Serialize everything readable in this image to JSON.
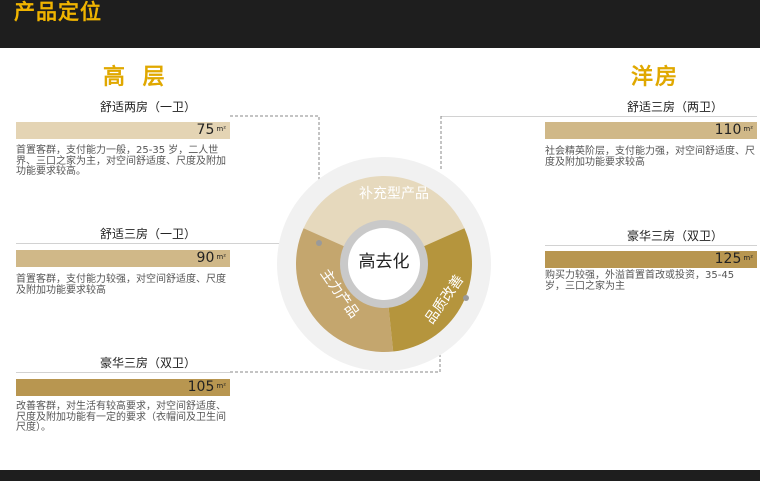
{
  "header": {
    "title": "产品定位"
  },
  "left": {
    "title": "高 层",
    "products": [
      {
        "name": "舒适两房（一卫）",
        "area": "75",
        "unit": "m²",
        "desc": "首置客群，支付能力一般，25-35 岁，二人世界、三口之家为主，对空间舒适度、尺度及附加功能要求较高。"
      },
      {
        "name": "舒适三房（一卫）",
        "area": "90",
        "unit": "m²",
        "desc": "首置客群，支付能力较强，对空间舒适度、尺度及附加功能要求较高"
      },
      {
        "name": "豪华三房（双卫）",
        "area": "105",
        "unit": "m²",
        "desc": "改善客群，对生活有较高要求，对空间舒适度、尺度及附加功能有一定的要求（衣帽间及卫生间尺度）。"
      }
    ]
  },
  "right": {
    "title": "洋房",
    "products": [
      {
        "name": "舒适三房（两卫）",
        "area": "110",
        "unit": "m²",
        "desc": "社会精英阶层，支付能力强，对空间舒适度、尺度及附加功能要求较高"
      },
      {
        "name": "豪华三房（双卫）",
        "area": "125",
        "unit": "m²",
        "desc": "购买力较强，外溢首置首改或投资，35-45 岁，三口之家为主"
      }
    ]
  },
  "diagram": {
    "center": "高去化",
    "segments": [
      "补充型产品",
      "主力产品",
      "品质改善"
    ]
  },
  "colors": {
    "accent": "#f0b400",
    "bar_light": "#e4d4b4",
    "bar_mid": "#d0b888",
    "bar_dark": "#b89650",
    "seg_top": "#e6d9bd",
    "seg_left": "#c4a66e",
    "seg_right": "#b5953d"
  }
}
